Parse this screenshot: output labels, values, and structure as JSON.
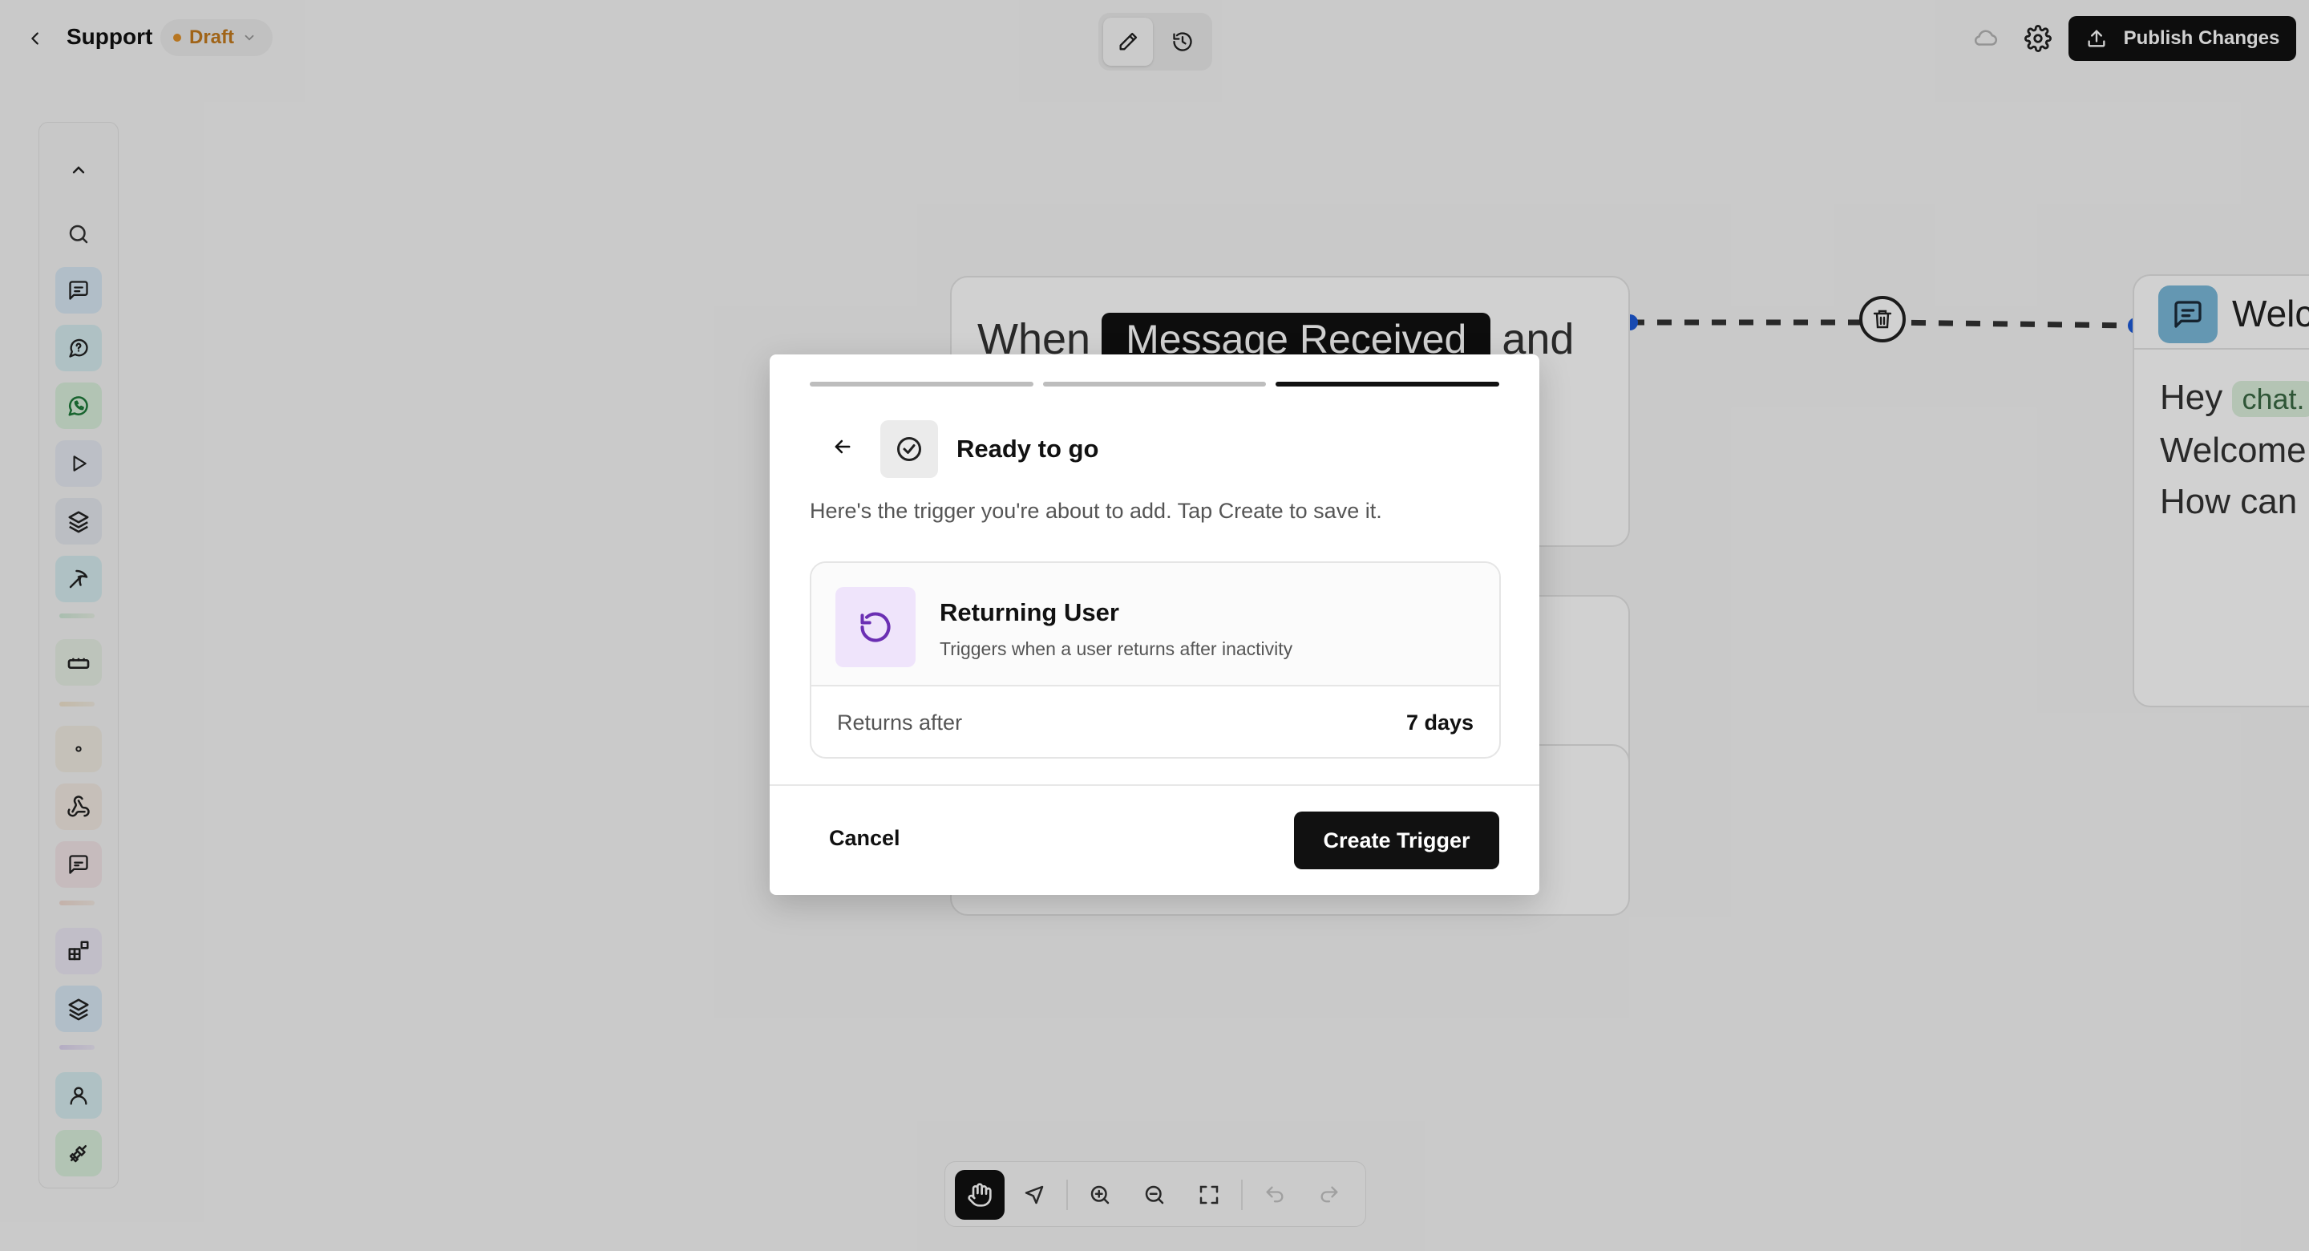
{
  "header": {
    "title": "Support",
    "status": "Draft",
    "publish_label": "Publish Changes"
  },
  "canvas": {
    "when_node": {
      "prefix": "When",
      "event": "Message Received",
      "suffix": "and"
    },
    "welcome_node": {
      "title": "Welc",
      "line1_word": "Hey",
      "line1_chip": "chat.",
      "line2": "Welcome",
      "line3": "How can"
    },
    "connector_color": "#333333",
    "handle_color": "#1e5bd8"
  },
  "sidebar": {
    "colors": [
      "#d8e8f4",
      "#d6ecef",
      "#d9f0dc",
      "#e6eaf2",
      "#e4e8ee",
      "#d6ecef",
      "#e7efe4",
      "#f1ece2",
      "#f2e9e2",
      "#f2e4e7",
      "#ece8f4"
    ]
  },
  "modal": {
    "progress": {
      "total_steps": 3,
      "current_step": 3
    },
    "title": "Ready to go",
    "description": "Here's the trigger you're about to add. Tap Create to save it.",
    "trigger": {
      "name": "Returning User",
      "description": "Triggers when a user returns after inactivity",
      "icon": "refresh-icon",
      "icon_bg": "#efe4fb",
      "icon_color": "#6b2fb3",
      "setting_label": "Returns after",
      "setting_value": "7 days"
    },
    "cancel_label": "Cancel",
    "create_label": "Create Trigger"
  }
}
